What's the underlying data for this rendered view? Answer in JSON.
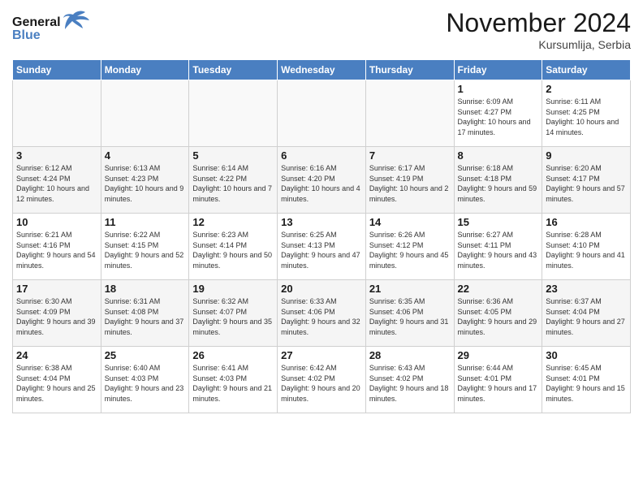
{
  "header": {
    "logo_line1": "General",
    "logo_line2": "Blue",
    "month_title": "November 2024",
    "location": "Kursumlija, Serbia"
  },
  "weekdays": [
    "Sunday",
    "Monday",
    "Tuesday",
    "Wednesday",
    "Thursday",
    "Friday",
    "Saturday"
  ],
  "weeks": [
    [
      {
        "day": "",
        "info": "",
        "empty": true
      },
      {
        "day": "",
        "info": "",
        "empty": true
      },
      {
        "day": "",
        "info": "",
        "empty": true
      },
      {
        "day": "",
        "info": "",
        "empty": true
      },
      {
        "day": "",
        "info": "",
        "empty": true
      },
      {
        "day": "1",
        "info": "Sunrise: 6:09 AM\nSunset: 4:27 PM\nDaylight: 10 hours and 17 minutes."
      },
      {
        "day": "2",
        "info": "Sunrise: 6:11 AM\nSunset: 4:25 PM\nDaylight: 10 hours and 14 minutes."
      }
    ],
    [
      {
        "day": "3",
        "info": "Sunrise: 6:12 AM\nSunset: 4:24 PM\nDaylight: 10 hours and 12 minutes."
      },
      {
        "day": "4",
        "info": "Sunrise: 6:13 AM\nSunset: 4:23 PM\nDaylight: 10 hours and 9 minutes."
      },
      {
        "day": "5",
        "info": "Sunrise: 6:14 AM\nSunset: 4:22 PM\nDaylight: 10 hours and 7 minutes."
      },
      {
        "day": "6",
        "info": "Sunrise: 6:16 AM\nSunset: 4:20 PM\nDaylight: 10 hours and 4 minutes."
      },
      {
        "day": "7",
        "info": "Sunrise: 6:17 AM\nSunset: 4:19 PM\nDaylight: 10 hours and 2 minutes."
      },
      {
        "day": "8",
        "info": "Sunrise: 6:18 AM\nSunset: 4:18 PM\nDaylight: 9 hours and 59 minutes."
      },
      {
        "day": "9",
        "info": "Sunrise: 6:20 AM\nSunset: 4:17 PM\nDaylight: 9 hours and 57 minutes."
      }
    ],
    [
      {
        "day": "10",
        "info": "Sunrise: 6:21 AM\nSunset: 4:16 PM\nDaylight: 9 hours and 54 minutes."
      },
      {
        "day": "11",
        "info": "Sunrise: 6:22 AM\nSunset: 4:15 PM\nDaylight: 9 hours and 52 minutes."
      },
      {
        "day": "12",
        "info": "Sunrise: 6:23 AM\nSunset: 4:14 PM\nDaylight: 9 hours and 50 minutes."
      },
      {
        "day": "13",
        "info": "Sunrise: 6:25 AM\nSunset: 4:13 PM\nDaylight: 9 hours and 47 minutes."
      },
      {
        "day": "14",
        "info": "Sunrise: 6:26 AM\nSunset: 4:12 PM\nDaylight: 9 hours and 45 minutes."
      },
      {
        "day": "15",
        "info": "Sunrise: 6:27 AM\nSunset: 4:11 PM\nDaylight: 9 hours and 43 minutes."
      },
      {
        "day": "16",
        "info": "Sunrise: 6:28 AM\nSunset: 4:10 PM\nDaylight: 9 hours and 41 minutes."
      }
    ],
    [
      {
        "day": "17",
        "info": "Sunrise: 6:30 AM\nSunset: 4:09 PM\nDaylight: 9 hours and 39 minutes."
      },
      {
        "day": "18",
        "info": "Sunrise: 6:31 AM\nSunset: 4:08 PM\nDaylight: 9 hours and 37 minutes."
      },
      {
        "day": "19",
        "info": "Sunrise: 6:32 AM\nSunset: 4:07 PM\nDaylight: 9 hours and 35 minutes."
      },
      {
        "day": "20",
        "info": "Sunrise: 6:33 AM\nSunset: 4:06 PM\nDaylight: 9 hours and 32 minutes."
      },
      {
        "day": "21",
        "info": "Sunrise: 6:35 AM\nSunset: 4:06 PM\nDaylight: 9 hours and 31 minutes."
      },
      {
        "day": "22",
        "info": "Sunrise: 6:36 AM\nSunset: 4:05 PM\nDaylight: 9 hours and 29 minutes."
      },
      {
        "day": "23",
        "info": "Sunrise: 6:37 AM\nSunset: 4:04 PM\nDaylight: 9 hours and 27 minutes."
      }
    ],
    [
      {
        "day": "24",
        "info": "Sunrise: 6:38 AM\nSunset: 4:04 PM\nDaylight: 9 hours and 25 minutes."
      },
      {
        "day": "25",
        "info": "Sunrise: 6:40 AM\nSunset: 4:03 PM\nDaylight: 9 hours and 23 minutes."
      },
      {
        "day": "26",
        "info": "Sunrise: 6:41 AM\nSunset: 4:03 PM\nDaylight: 9 hours and 21 minutes."
      },
      {
        "day": "27",
        "info": "Sunrise: 6:42 AM\nSunset: 4:02 PM\nDaylight: 9 hours and 20 minutes."
      },
      {
        "day": "28",
        "info": "Sunrise: 6:43 AM\nSunset: 4:02 PM\nDaylight: 9 hours and 18 minutes."
      },
      {
        "day": "29",
        "info": "Sunrise: 6:44 AM\nSunset: 4:01 PM\nDaylight: 9 hours and 17 minutes."
      },
      {
        "day": "30",
        "info": "Sunrise: 6:45 AM\nSunset: 4:01 PM\nDaylight: 9 hours and 15 minutes."
      }
    ]
  ]
}
